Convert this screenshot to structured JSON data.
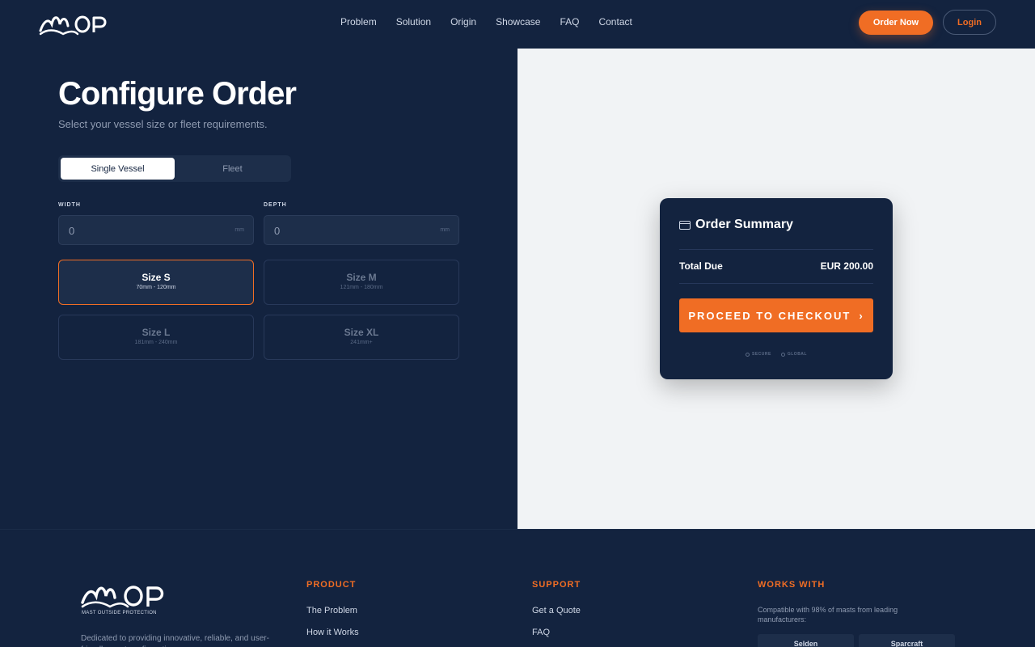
{
  "brand": {
    "name": "MOP",
    "tagline": "MAST OUTSIDE PROTECTION"
  },
  "nav": {
    "links": [
      "Problem",
      "Solution",
      "Origin",
      "Showcase",
      "FAQ",
      "Contact"
    ],
    "order_now": "Order Now",
    "login": "Login"
  },
  "config": {
    "title": "Configure Order",
    "subtitle": "Select your vessel size or fleet requirements.",
    "toggle": {
      "single": "Single Vessel",
      "fleet": "Fleet",
      "selected": "Single Vessel"
    },
    "width": {
      "label": "WIDTH",
      "value": "0",
      "unit": "mm"
    },
    "depth": {
      "label": "DEPTH",
      "value": "0",
      "unit": "mm"
    },
    "sizes": [
      {
        "name": "Size S",
        "range": "70mm - 120mm",
        "selected": true
      },
      {
        "name": "Size M",
        "range": "121mm - 180mm",
        "selected": false
      },
      {
        "name": "Size L",
        "range": "181mm - 240mm",
        "selected": false
      },
      {
        "name": "Size XL",
        "range": "241mm+",
        "selected": false
      }
    ]
  },
  "summary": {
    "title": "Order Summary",
    "total_label": "Total Due",
    "total_value": "EUR 200.00",
    "checkout": "PROCEED TO CHECKOUT",
    "badges": [
      "SECURE",
      "GLOBAL"
    ]
  },
  "footer": {
    "description": "Dedicated to providing innovative, reliable, and user-friendly mast configuration",
    "product": {
      "heading": "PRODUCT",
      "links": [
        "The Problem",
        "How it Works"
      ]
    },
    "support": {
      "heading": "SUPPORT",
      "links": [
        "Get a Quote",
        "FAQ"
      ]
    },
    "works_with": {
      "heading": "WORKS WITH",
      "note": "Compatible with 98% of masts from leading manufacturers:",
      "makers": [
        "Selden",
        "Sparcraft"
      ]
    }
  },
  "colors": {
    "accent": "#f06d24",
    "navy": "#13233f",
    "light_panel": "#f1f3f5"
  }
}
